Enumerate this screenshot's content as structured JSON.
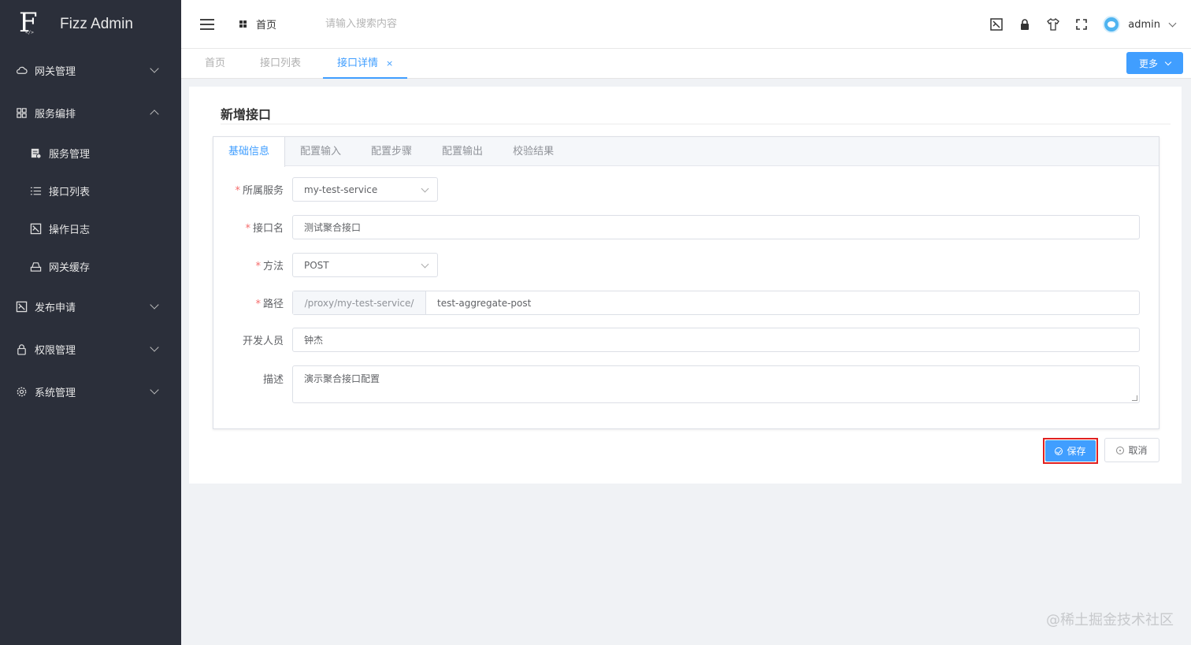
{
  "app": {
    "title": "Fizz Admin",
    "logo_code": "</>"
  },
  "sidebar": {
    "items": [
      {
        "label": "网关管理",
        "icon": "cloud-icon",
        "expanded": false
      },
      {
        "label": "服务编排",
        "icon": "grid-icon",
        "expanded": true,
        "children": [
          {
            "label": "服务管理",
            "icon": "document-icon"
          },
          {
            "label": "接口列表",
            "icon": "list-icon"
          },
          {
            "label": "操作日志",
            "icon": "log-icon"
          },
          {
            "label": "网关缓存",
            "icon": "cache-icon"
          }
        ]
      },
      {
        "label": "发布申请",
        "icon": "publish-icon",
        "expanded": false
      },
      {
        "label": "权限管理",
        "icon": "lock-icon",
        "expanded": false
      },
      {
        "label": "系统管理",
        "icon": "gear-icon",
        "expanded": false
      }
    ]
  },
  "header": {
    "home_label": "首页",
    "search_placeholder": "请输入搜索内容",
    "user_name": "admin"
  },
  "nav_tabs": [
    {
      "label": "首页",
      "active": false
    },
    {
      "label": "接口列表",
      "active": false
    },
    {
      "label": "接口详情",
      "active": true,
      "close": "×"
    }
  ],
  "more_button": "更多",
  "page": {
    "title": "新增接口",
    "form_tabs": [
      "基础信息",
      "配置输入",
      "配置步骤",
      "配置输出",
      "校验结果"
    ],
    "fields": {
      "service": {
        "label": "所属服务",
        "value": "my-test-service",
        "required": true
      },
      "name": {
        "label": "接口名",
        "value": "测试聚合接口",
        "required": true
      },
      "method": {
        "label": "方法",
        "value": "POST",
        "required": true
      },
      "path": {
        "label": "路径",
        "prefix": "/proxy/my-test-service/",
        "value": "test-aggregate-post",
        "required": true
      },
      "developer": {
        "label": "开发人员",
        "value": "钟杰",
        "required": false
      },
      "description": {
        "label": "描述",
        "value": "演示聚合接口配置",
        "required": false
      }
    },
    "required_mark": "*",
    "save_label": "保存",
    "cancel_label": "取消"
  },
  "watermark": "@稀土掘金技术社区",
  "colors": {
    "primary": "#409eff",
    "sidebar_bg": "#2b2f3a",
    "required": "#f56c6c",
    "highlight_border": "#e02020"
  }
}
